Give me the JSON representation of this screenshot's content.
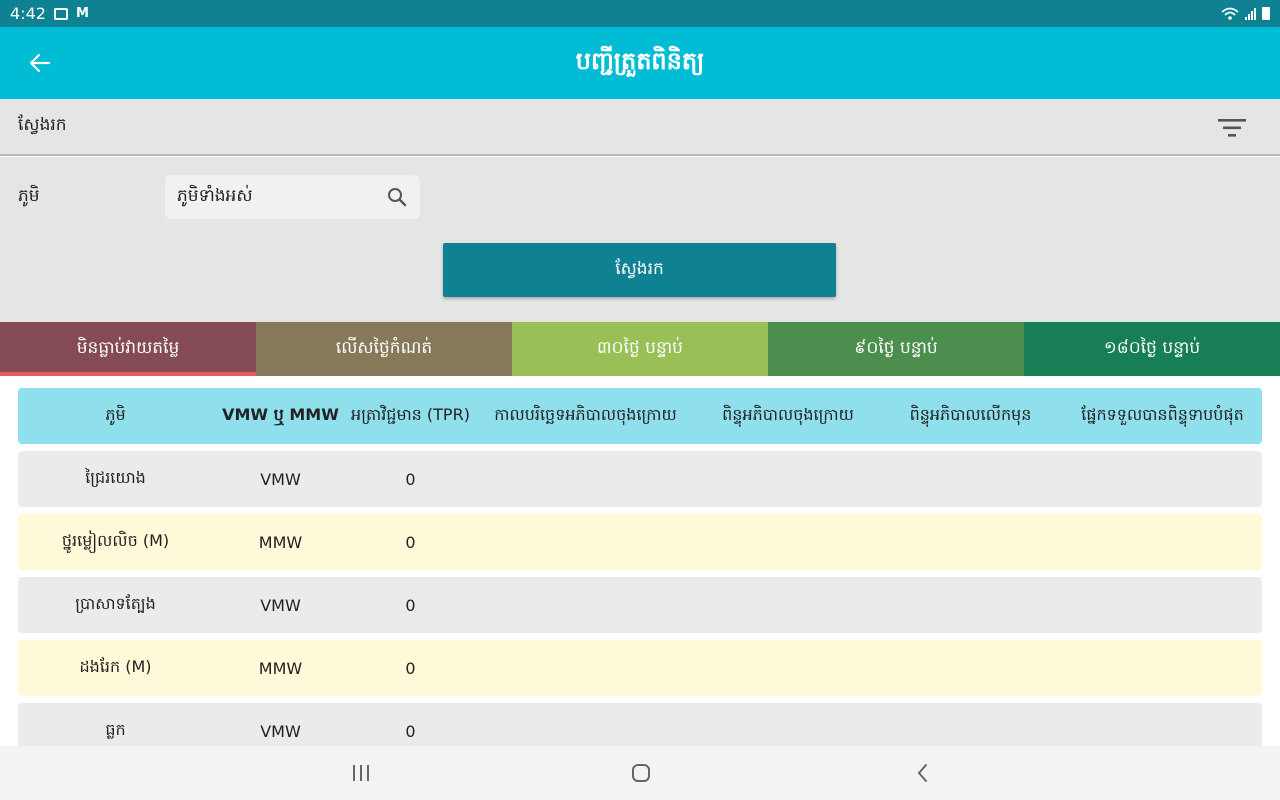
{
  "status": {
    "time": "4:42"
  },
  "appbar": {
    "title": "បញ្ជីត្រួតពិនិត្យ"
  },
  "filterbar": {
    "label": "ស្វែងរក"
  },
  "search": {
    "village_label": "ភូមិ",
    "input_value": "ភូមិទាំងអស់",
    "button_label": "ស្វែងរក"
  },
  "tabs": [
    {
      "label": "មិនធ្លាប់វាយតម្លៃ",
      "color": "#854b55"
    },
    {
      "label": "លើសថ្ងៃកំណត់",
      "color": "#857959"
    },
    {
      "label": "៣០ថ្ងៃ បន្ទាប់",
      "color": "#99c057"
    },
    {
      "label": "៩០ថ្ងៃ បន្ទាប់",
      "color": "#4b8e4e"
    },
    {
      "label": "១៨០ថ្ងៃ បន្ទាប់",
      "color": "#177e55"
    }
  ],
  "table": {
    "headers": [
      "ភូមិ",
      "VMW ឬ MMW",
      "អត្រាវិជ្ជមាន (TPR)",
      "កាលបរិច្ឆេទអភិបាលចុងក្រោយ",
      "ពិន្ទុអភិបាលចុងក្រោយ",
      "ពិន្ទុអភិបាលលើកមុន",
      "ផ្នែកទទួលបានពិន្ទុទាបបំផុត"
    ],
    "rows": [
      [
        "ជ្រៃរយោង",
        "VMW",
        "0",
        "",
        "",
        "",
        ""
      ],
      [
        "ថ្នូរម្លៀលលិច (M)",
        "MMW",
        "0",
        "",
        "",
        "",
        ""
      ],
      [
        "ប្រាសាទត្បែង",
        "VMW",
        "0",
        "",
        "",
        "",
        ""
      ],
      [
        "ដងរែក (M)",
        "MMW",
        "0",
        "",
        "",
        "",
        ""
      ],
      [
        "ធ្លក",
        "VMW",
        "0",
        "",
        "",
        "",
        ""
      ]
    ]
  }
}
